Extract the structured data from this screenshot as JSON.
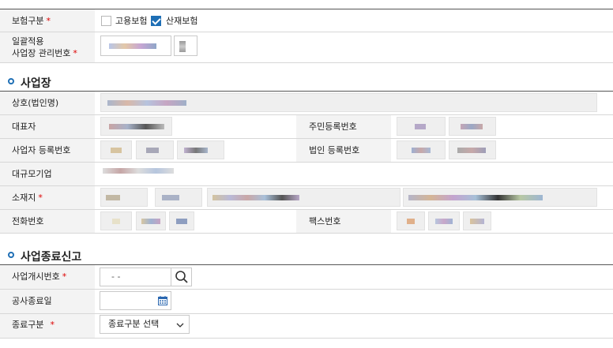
{
  "form": {
    "insurance_type": {
      "label": "보험구분",
      "required_mark": "*",
      "options": [
        {
          "label": "고용보험",
          "checked": false
        },
        {
          "label": "산재보험",
          "checked": true
        }
      ]
    },
    "bulk_apply": {
      "label_line1": "일괄적용",
      "label_line2": "사업장 관리번호",
      "required_mark": "*"
    }
  },
  "business_section": {
    "title": "사업장",
    "fields": {
      "company_name": "상호(법인명)",
      "representative": "대표자",
      "resident_no": "주민등록번호",
      "business_reg_no": "사업자 등록번호",
      "corp_reg_no": "법인 등록번호",
      "large_company": "대규모기업",
      "address": "소재지",
      "address_required": "*",
      "phone": "전화번호",
      "fax": "팩스번호"
    }
  },
  "termination_section": {
    "title": "사업종료신고",
    "start_no": {
      "label": "사업개시번호",
      "required_mark": "*",
      "value": "-  -",
      "search_icon": "search-icon"
    },
    "end_date": {
      "label": "공사종료일",
      "value": "",
      "calendar_icon": "calendar-icon"
    },
    "end_type": {
      "label": "종료구분",
      "required_mark": "*",
      "selected": "종료구분 선택",
      "dropdown_icon": "chevron-down-icon"
    }
  },
  "colors": {
    "accent": "#1f6fb5",
    "required": "#dd0000",
    "label_bg": "#f3f3f3",
    "field_bg": "#efefef"
  }
}
